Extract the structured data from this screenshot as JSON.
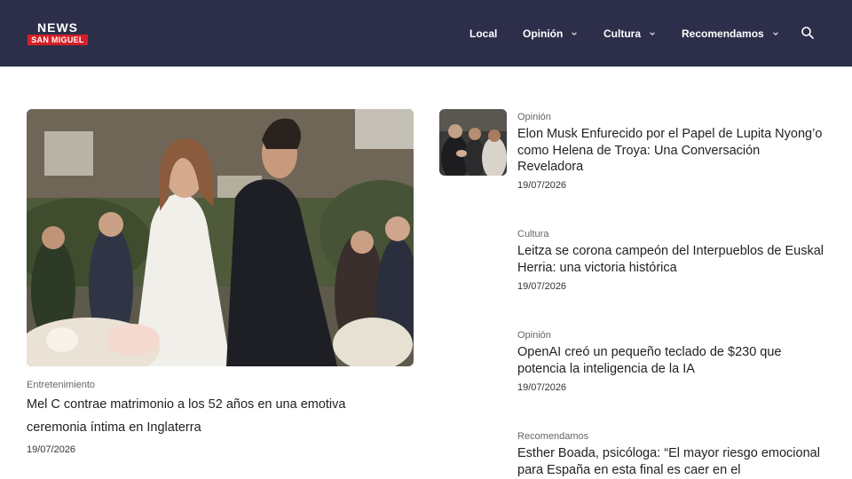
{
  "brand": {
    "top": "NEWS",
    "bottom": "SAN MIGUEL"
  },
  "nav": {
    "local": "Local",
    "opinion": "Opinión",
    "cultura": "Cultura",
    "recomendamos": "Recomendamos"
  },
  "icons": {
    "search": "search-icon",
    "dropdown": "chevron-down-icon"
  },
  "colors": {
    "header_bg": "#2d2f4a",
    "logo_red": "#d61f26"
  },
  "featured": {
    "category": "Entretenimiento",
    "title": "Mel C contrae matrimonio a los 52 años en una emotiva ceremonia íntima en Inglaterra",
    "date": "19/07/2026"
  },
  "articles": [
    {
      "category": "Opinión",
      "title": "Elon Musk Enfurecido por el Papel de Lupita Nyong’o como Helena de Troya: Una Conversación Reveladora",
      "date": "19/07/2026"
    },
    {
      "category": "Cultura",
      "title": "Leitza se corona campeón del Interpueblos de Euskal Herria: una victoria histórica",
      "date": "19/07/2026"
    },
    {
      "category": "Opinión",
      "title": "OpenAI creó un pequeño teclado de $230 que potencia la inteligencia de la IA",
      "date": "19/07/2026"
    },
    {
      "category": "Recomendamos",
      "title": "Esther Boada, psicóloga: “El mayor riesgo emocional para España en esta final es caer en el"
    }
  ]
}
